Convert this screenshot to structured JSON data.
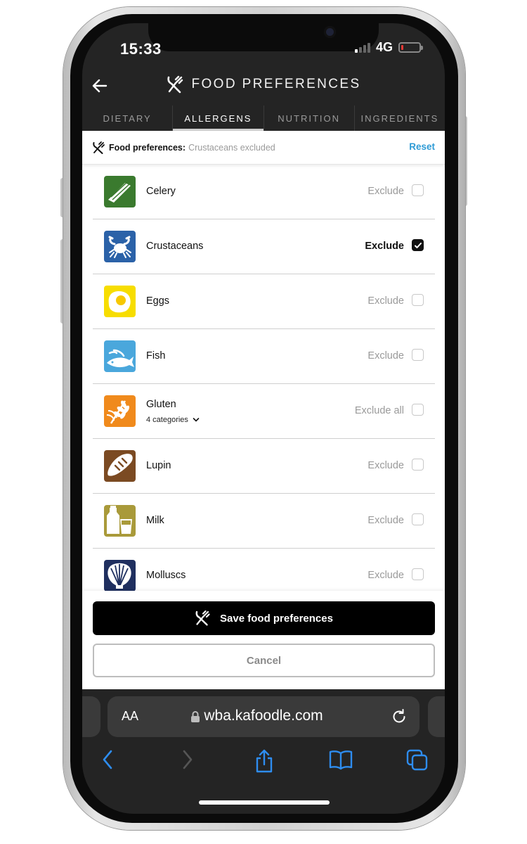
{
  "status_bar": {
    "time": "15:33",
    "network": "4G"
  },
  "header": {
    "title": "FOOD PREFERENCES"
  },
  "tabs": [
    {
      "label": "DIETARY",
      "active": false
    },
    {
      "label": "ALLERGENS",
      "active": true
    },
    {
      "label": "NUTRITION",
      "active": false
    },
    {
      "label": "INGREDIENTS",
      "active": false
    }
  ],
  "preferences_bar": {
    "label": "Food preferences:",
    "value": "Crustaceans excluded",
    "reset_label": "Reset"
  },
  "allergens": [
    {
      "name": "Celery",
      "exclude_label": "Exclude",
      "checked": false,
      "icon": "celery-icon",
      "color": "#3a7a2e"
    },
    {
      "name": "Crustaceans",
      "exclude_label": "Exclude",
      "checked": true,
      "icon": "crab-icon",
      "color": "#2b62a8"
    },
    {
      "name": "Eggs",
      "exclude_label": "Exclude",
      "checked": false,
      "icon": "egg-icon",
      "color": "#f7dd00"
    },
    {
      "name": "Fish",
      "exclude_label": "Exclude",
      "checked": false,
      "icon": "fish-icon",
      "color": "#4aa7dc"
    },
    {
      "name": "Gluten",
      "sub_label": "4 categories",
      "exclude_label": "Exclude all",
      "checked": false,
      "icon": "wheat-icon",
      "color": "#f08a1c"
    },
    {
      "name": "Lupin",
      "exclude_label": "Exclude",
      "checked": false,
      "icon": "bread-icon",
      "color": "#7b4a22"
    },
    {
      "name": "Milk",
      "exclude_label": "Exclude",
      "checked": false,
      "icon": "milk-icon",
      "color": "#a99a3a"
    },
    {
      "name": "Molluscs",
      "exclude_label": "Exclude",
      "checked": false,
      "icon": "shell-icon",
      "color": "#1f2f5f"
    }
  ],
  "footer": {
    "save_label": "Save food preferences",
    "cancel_label": "Cancel"
  },
  "browser": {
    "text_size_label": "AA",
    "url": "wba.kafoodle.com"
  }
}
